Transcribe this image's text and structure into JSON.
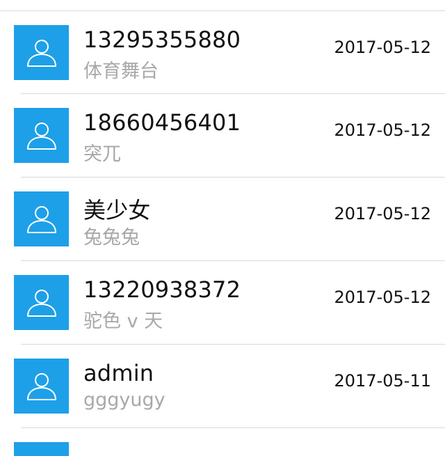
{
  "contacts": [
    {
      "name": "13295355880",
      "subtitle": "体育舞台",
      "date": "2017-05-12",
      "icon": "user-icon"
    },
    {
      "name": "18660456401",
      "subtitle": "突兀",
      "date": "2017-05-12",
      "icon": "user-icon"
    },
    {
      "name": "美少女",
      "subtitle": "兔兔兔",
      "date": "2017-05-12",
      "icon": "user-icon"
    },
    {
      "name": "13220938372",
      "subtitle": "驼色 v 天",
      "date": "2017-05-12",
      "icon": "user-icon"
    },
    {
      "name": "admin",
      "subtitle": "gggyugy",
      "date": "2017-05-11",
      "icon": "user-icon"
    }
  ],
  "colors": {
    "avatar_bg": "#1da0e8",
    "name_text": "#111111",
    "subtitle_text": "#a8a8a8",
    "separator": "#d9d9d9"
  }
}
